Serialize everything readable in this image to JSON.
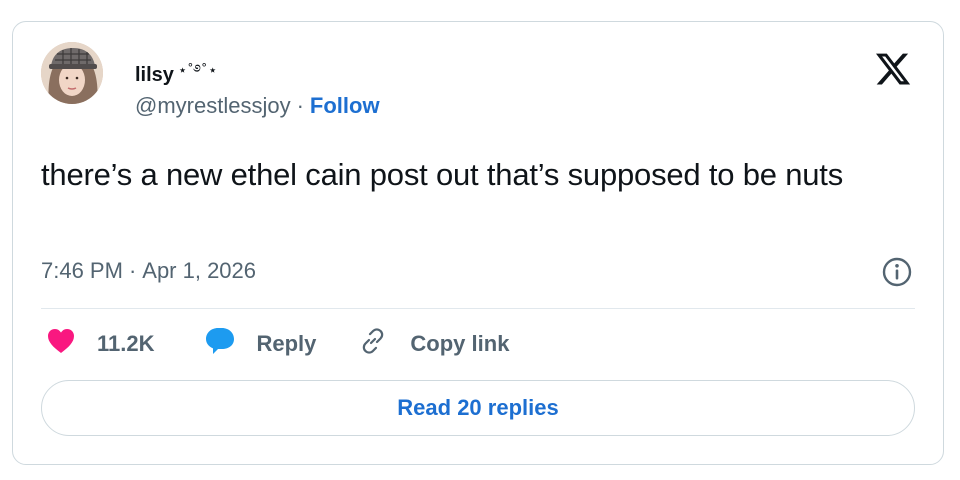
{
  "author": {
    "display_name": "lilsy",
    "name_decoration": "⋆˚࿔˚⋆",
    "handle": "@myrestlessjoy",
    "separator": "·",
    "follow_label": "Follow"
  },
  "tweet": {
    "text": "there’s a new ethel cain post out that’s supposed to be nuts",
    "time": "7:46 PM",
    "separator": "·",
    "date": "Apr 1, 2026"
  },
  "actions": {
    "like_count": "11.2K",
    "reply_label": "Reply",
    "copy_link_label": "Copy link"
  },
  "read_replies_label": "Read 20 replies",
  "icons": {
    "logo": "x-logo-icon",
    "info": "info-icon",
    "like": "heart-icon",
    "reply": "speech-bubble-icon",
    "copy": "link-icon"
  },
  "colors": {
    "link_blue": "#1d6fd1",
    "heart_pink": "#f91880",
    "reply_blue": "#1d9bf0",
    "muted_text": "#536471",
    "border": "#cfd9de"
  }
}
